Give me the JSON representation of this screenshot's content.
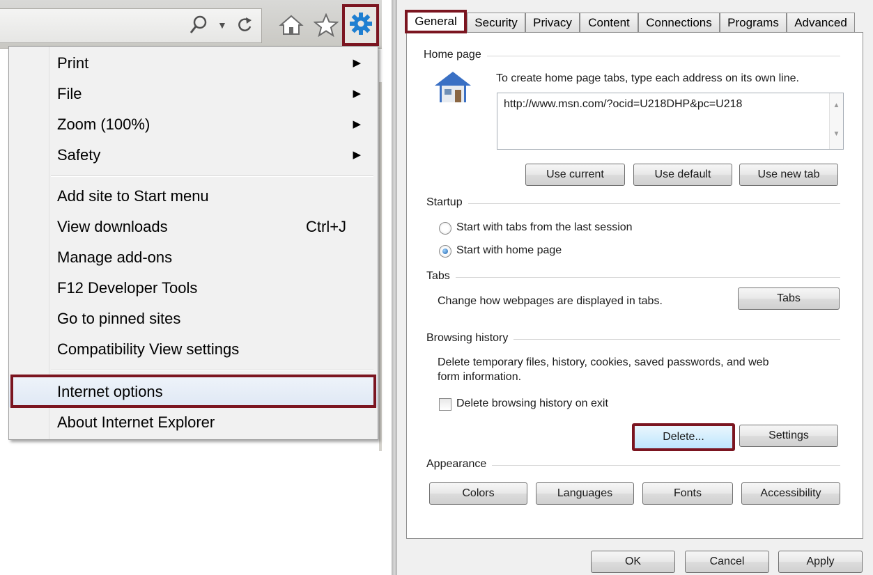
{
  "browser_toolbar": {
    "search_icon": "search-icon",
    "dropdown_icon": "chevron-down-icon",
    "refresh_icon": "refresh-icon",
    "home_icon": "home-icon",
    "favorites_icon": "star-icon",
    "tools_icon": "gear-icon",
    "accent_color": "#7b1520",
    "gear_color": "#1e7fd1"
  },
  "tools_menu": {
    "items": [
      {
        "label": "Print",
        "submenu": true
      },
      {
        "label": "File",
        "submenu": true
      },
      {
        "label": "Zoom (100%)",
        "submenu": true
      },
      {
        "label": "Safety",
        "submenu": true
      },
      {
        "label": "Add site to Start menu"
      },
      {
        "label": "View downloads",
        "shortcut": "Ctrl+J"
      },
      {
        "label": "Manage add-ons"
      },
      {
        "label": "F12 Developer Tools"
      },
      {
        "label": "Go to pinned sites"
      },
      {
        "label": "Compatibility View settings"
      },
      {
        "label": "Internet options",
        "highlighted": true
      },
      {
        "label": "About Internet Explorer"
      }
    ]
  },
  "options_dialog": {
    "tabs": [
      "General",
      "Security",
      "Privacy",
      "Content",
      "Connections",
      "Programs",
      "Advanced"
    ],
    "active_tab": "General",
    "home_page": {
      "group_label": "Home page",
      "instruction": "To create home page tabs, type each address on its own line.",
      "url": "http://www.msn.com/?ocid=U218DHP&pc=U218",
      "buttons": {
        "use_current": "Use current",
        "use_default": "Use default",
        "use_new_tab": "Use new tab"
      }
    },
    "startup": {
      "group_label": "Startup",
      "options": [
        "Start with tabs from the last session",
        "Start with home page"
      ],
      "selected_index": 1
    },
    "tabs_group": {
      "group_label": "Tabs",
      "description": "Change how webpages are displayed in tabs.",
      "button": "Tabs"
    },
    "browsing_history": {
      "group_label": "Browsing history",
      "description_line1": "Delete temporary files, history, cookies, saved passwords, and web",
      "description_line2": "form information.",
      "checkbox_label": "Delete browsing history on exit",
      "checkbox_checked": false,
      "buttons": {
        "delete": "Delete...",
        "settings": "Settings"
      }
    },
    "appearance": {
      "group_label": "Appearance",
      "buttons": [
        "Colors",
        "Languages",
        "Fonts",
        "Accessibility"
      ]
    },
    "footer_buttons": {
      "ok": "OK",
      "cancel": "Cancel",
      "apply": "Apply"
    }
  }
}
